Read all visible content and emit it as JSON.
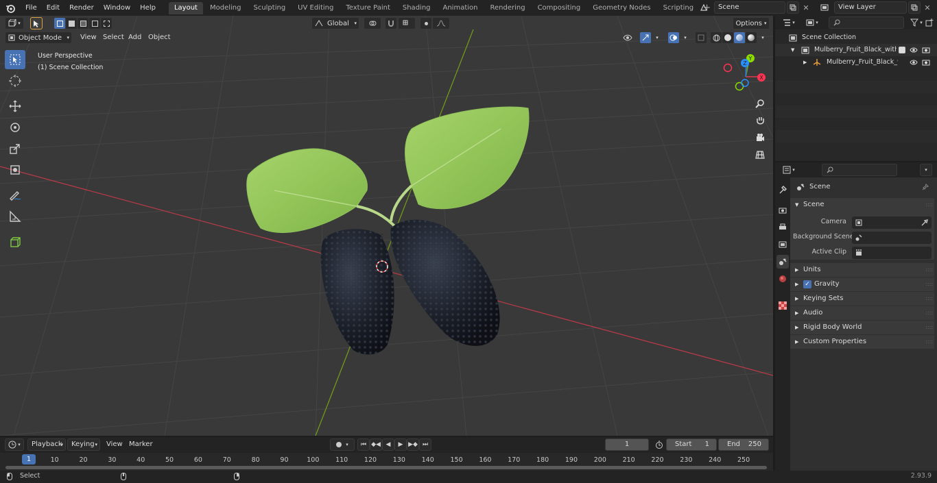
{
  "topbar": {
    "menus": [
      "File",
      "Edit",
      "Render",
      "Window",
      "Help"
    ],
    "workspaces": [
      "Layout",
      "Modeling",
      "Sculpting",
      "UV Editing",
      "Texture Paint",
      "Shading",
      "Animation",
      "Rendering",
      "Compositing",
      "Geometry Nodes",
      "Scripting"
    ],
    "active_workspace": "Layout",
    "scene_name": "Scene",
    "view_layer": "View Layer"
  },
  "viewport": {
    "mode": "Object Mode",
    "menus": [
      "View",
      "Select",
      "Add",
      "Object"
    ],
    "transform_orientation": "Global",
    "options_label": "Options",
    "perspective_label": "User Perspective",
    "collection_label": "(1) Scene Collection",
    "gizmo": {
      "x": "X",
      "y": "Y",
      "z": "Z"
    }
  },
  "outliner": {
    "root": "Scene Collection",
    "items": [
      {
        "name": "Mulberry_Fruit_Black_with_Le"
      },
      {
        "name": "Mulberry_Fruit_Black_wit"
      }
    ]
  },
  "properties": {
    "header": "Scene",
    "section": "Scene",
    "fields": [
      {
        "label": "Camera"
      },
      {
        "label": "Background Scene"
      },
      {
        "label": "Active Clip"
      }
    ],
    "panels": [
      "Units",
      "Gravity",
      "Keying Sets",
      "Audio",
      "Rigid Body World",
      "Custom Properties"
    ],
    "gravity_checked": true
  },
  "timeline": {
    "menus": [
      "Playback",
      "Keying",
      "View",
      "Marker"
    ],
    "current_frame": "1",
    "start_label": "Start",
    "start_value": "1",
    "end_label": "End",
    "end_value": "250",
    "ticks": [
      "10",
      "20",
      "30",
      "40",
      "50",
      "60",
      "70",
      "80",
      "90",
      "100",
      "110",
      "120",
      "130",
      "140",
      "150",
      "160",
      "170",
      "180",
      "190",
      "200",
      "210",
      "220",
      "230",
      "240",
      "250"
    ],
    "cursor_label": "1"
  },
  "statusbar": {
    "select_label": "Select",
    "version": "2.93.9"
  },
  "colors": {
    "accent": "#4772b3",
    "axis_x": "#ff3352",
    "axis_y": "#8bdc00",
    "axis_z": "#2890ff",
    "grid": "#4a4a4a",
    "viewport_bg": "#393939"
  }
}
